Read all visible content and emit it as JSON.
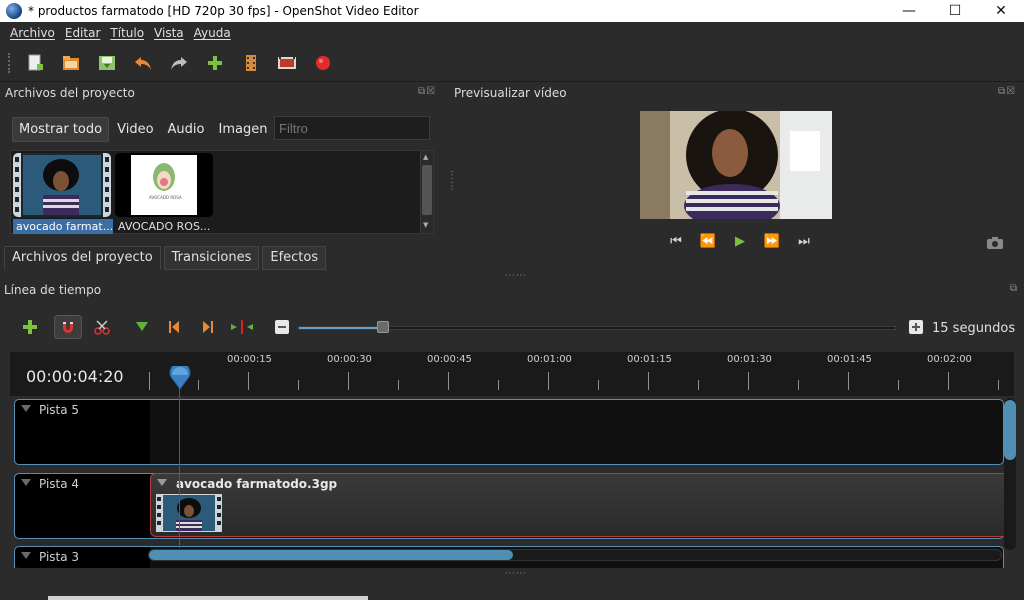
{
  "window": {
    "title": "* productos farmatodo [HD 720p 30 fps] - OpenShot Video Editor",
    "minimize": "—",
    "maximize": "☐",
    "close": "✕"
  },
  "menu": [
    "Archivo",
    "Editar",
    "Título",
    "Vista",
    "Ayuda"
  ],
  "toolbar_icons": [
    "new-project-icon",
    "open-project-icon",
    "save-project-icon",
    "undo-icon",
    "redo-icon",
    "import-files-icon",
    "choose-profile-icon",
    "export-film-icon",
    "record-icon"
  ],
  "project_panel": {
    "title": "Archivos del proyecto",
    "filters": [
      "Mostrar todo",
      "Video",
      "Audio",
      "Imagen"
    ],
    "filter_placeholder": "Filtro",
    "files": [
      {
        "label": "avocado farmat...",
        "selected": true
      },
      {
        "label": "AVOCADO ROS...",
        "selected": false
      }
    ],
    "logo_text": "AVOCADO ROSA",
    "tabs": [
      "Archivos del proyecto",
      "Transiciones",
      "Efectos"
    ]
  },
  "preview": {
    "title": "Previsualizar vídeo",
    "controls": [
      "⏮",
      "⏪",
      "▶",
      "⏩",
      "⏭"
    ]
  },
  "timeline": {
    "title": "Línea de tiempo",
    "zoom_label": "15 segundos",
    "zoom_level": 0.14,
    "timecode": "00:00:04:20",
    "ruler_labels": [
      "00:00:15",
      "00:00:30",
      "00:00:45",
      "00:01:00",
      "00:01:15",
      "00:01:30",
      "00:01:45",
      "00:02:00"
    ],
    "tracks": [
      {
        "name": "Pista 5"
      },
      {
        "name": "Pista 4"
      },
      {
        "name": "Pista 3"
      }
    ],
    "clip_name": "avocado farmatodo.3gp"
  },
  "colors": {
    "accent_blue": "#5e9fd0",
    "playhead_red": "#e02020",
    "clip_border": "#b83a3a",
    "background": "#2b2b2b"
  }
}
